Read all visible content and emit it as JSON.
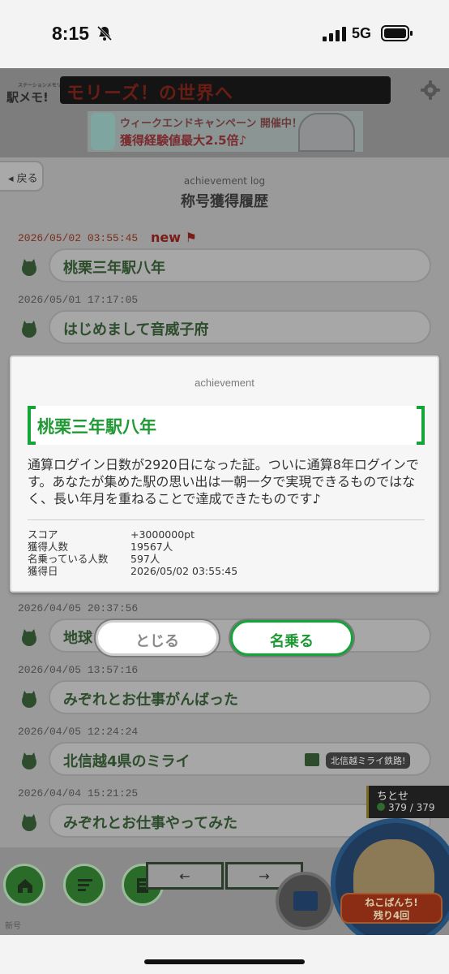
{
  "status": {
    "time": "8:15",
    "network": "5G"
  },
  "header": {
    "logo": "駅メモ!",
    "logo_sub": "ステーションメモリーズ!",
    "ticker": "モリーズ！の世界へ",
    "banner": {
      "line1": "ウィークエンドキャンペーン 開催中！",
      "line2": "獲得経験値最大2.5倍♪"
    }
  },
  "nav": {
    "back_label": "戻る"
  },
  "page": {
    "subtitle": "achievement log",
    "title": "称号獲得履歴"
  },
  "log": [
    {
      "date": "2026/05/02 03:55:45",
      "name": "桃栗三年駅八年",
      "is_new": true,
      "new_label": "new"
    },
    {
      "date": "2026/05/01 17:17:05",
      "name": "はじめまして音威子府"
    },
    {
      "date": "2026/04/05 20:37:56",
      "name": "地球"
    },
    {
      "date": "2026/04/05 13:57:16",
      "name": "みぞれとお仕事がんばった"
    },
    {
      "date": "2026/04/05 12:24:24",
      "name": "北信越4県のミライ",
      "badge": "北信越ミライ鉄路!"
    },
    {
      "date": "2026/04/04 15:21:25",
      "name": "みぞれとお仕事やってみた"
    }
  ],
  "modal": {
    "header": "achievement",
    "title": "桃栗三年駅八年",
    "description": "通算ログイン日数が2920日になった証。ついに通算8年ログインです。あなたが集めた駅の思い出は一朝一夕で実現できるものではなく、長い年月を重ねることで達成できたものです♪",
    "stats": [
      {
        "label": "スコア",
        "value": "+3000000pt"
      },
      {
        "label": "獲得人数",
        "value": "19567人"
      },
      {
        "label": "名乗っている人数",
        "value": "597人"
      },
      {
        "label": "獲得日",
        "value": "2026/05/02 03:55:45"
      }
    ],
    "close_label": "とじる",
    "claim_label": "名乗る"
  },
  "bottom": {
    "prev_label": "←",
    "next_label": "→",
    "caption": "新号",
    "character": {
      "name": "ちとせ",
      "hp": "379 / 379"
    },
    "neko_label_1": "ねこぱんち!",
    "neko_label_2": "残り4回"
  },
  "colors": {
    "accent_green": "#13a537",
    "overlay_dim": "#9a9a9a"
  }
}
